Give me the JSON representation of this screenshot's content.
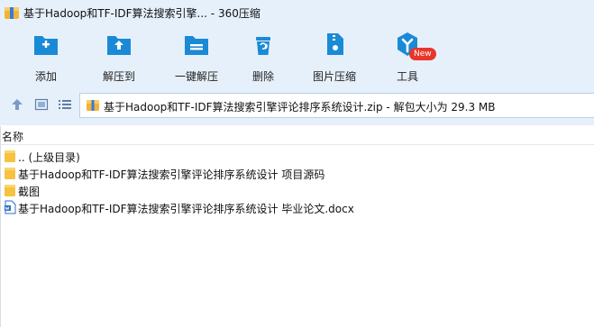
{
  "window": {
    "title": "基于Hadoop和TF-IDF算法搜索引擎... - 360压缩"
  },
  "toolbar": {
    "items": [
      {
        "label": "添加",
        "icon": "add-icon"
      },
      {
        "label": "解压到",
        "icon": "extract-to-icon"
      },
      {
        "label": "一键解压",
        "icon": "one-click-extract-icon"
      },
      {
        "label": "删除",
        "icon": "delete-icon"
      },
      {
        "label": "图片压缩",
        "icon": "image-compress-icon"
      },
      {
        "label": "工具",
        "icon": "tools-icon"
      }
    ],
    "badge": "New"
  },
  "address": {
    "text": "基于Hadoop和TF-IDF算法搜索引擎评论排序系统设计.zip - 解包大小为 29.3 MB"
  },
  "list": {
    "header": "名称",
    "rows": [
      {
        "name": ".. (上级目录)",
        "type": "folder"
      },
      {
        "name": "基于Hadoop和TF-IDF算法搜索引擎评论排序系统设计 项目源码",
        "type": "folder"
      },
      {
        "name": "截图",
        "type": "folder"
      },
      {
        "name": "基于Hadoop和TF-IDF算法搜索引擎评论排序系统设计 毕业论文.docx",
        "type": "docx"
      }
    ]
  },
  "colors": {
    "accent": "#1a8ad6",
    "toolbar_bg": "#e6f0fb",
    "folder": "#f6c341",
    "badge": "#e8362b"
  }
}
